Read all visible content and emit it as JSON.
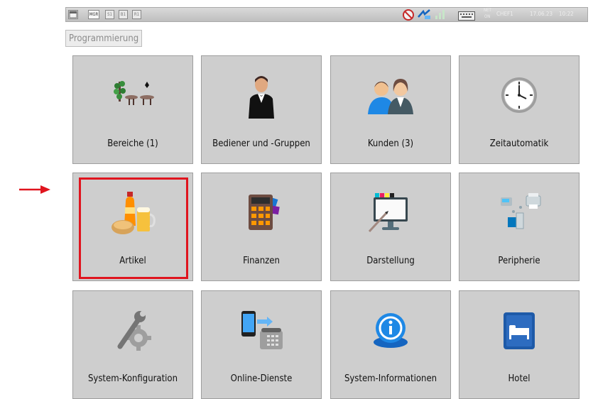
{
  "status_bar": {
    "mode_label": "MGR",
    "slots": [
      "S1",
      "B1",
      "R1"
    ],
    "net_label_top": "NET",
    "net_label_bottom": "ON",
    "user": "CHEF1",
    "date": "17.06.23",
    "time": "10:22"
  },
  "tab": {
    "label": "Programmierung"
  },
  "tiles": [
    {
      "label": "Bereiche (1)",
      "icon": "areas-icon"
    },
    {
      "label": "Bediener und -Gruppen",
      "icon": "waiter-icon"
    },
    {
      "label": "Kunden (3)",
      "icon": "customers-icon"
    },
    {
      "label": "Zeitautomatik",
      "icon": "clock-icon"
    },
    {
      "label": "Artikel",
      "icon": "food-drink-icon"
    },
    {
      "label": "Finanzen",
      "icon": "calculator-icon"
    },
    {
      "label": "Darstellung",
      "icon": "monitor-icon"
    },
    {
      "label": "Peripherie",
      "icon": "peripherals-icon"
    },
    {
      "label": "System-Konfiguration",
      "icon": "wrench-gear-icon"
    },
    {
      "label": "Online-Dienste",
      "icon": "phone-transfer-icon"
    },
    {
      "label": "System-Informationen",
      "icon": "info-icon"
    },
    {
      "label": "Hotel",
      "icon": "hotel-bed-icon"
    }
  ],
  "selected_tile": "Artikel",
  "colors": {
    "highlight": "#e0141e",
    "tile_bg": "#cecece"
  }
}
